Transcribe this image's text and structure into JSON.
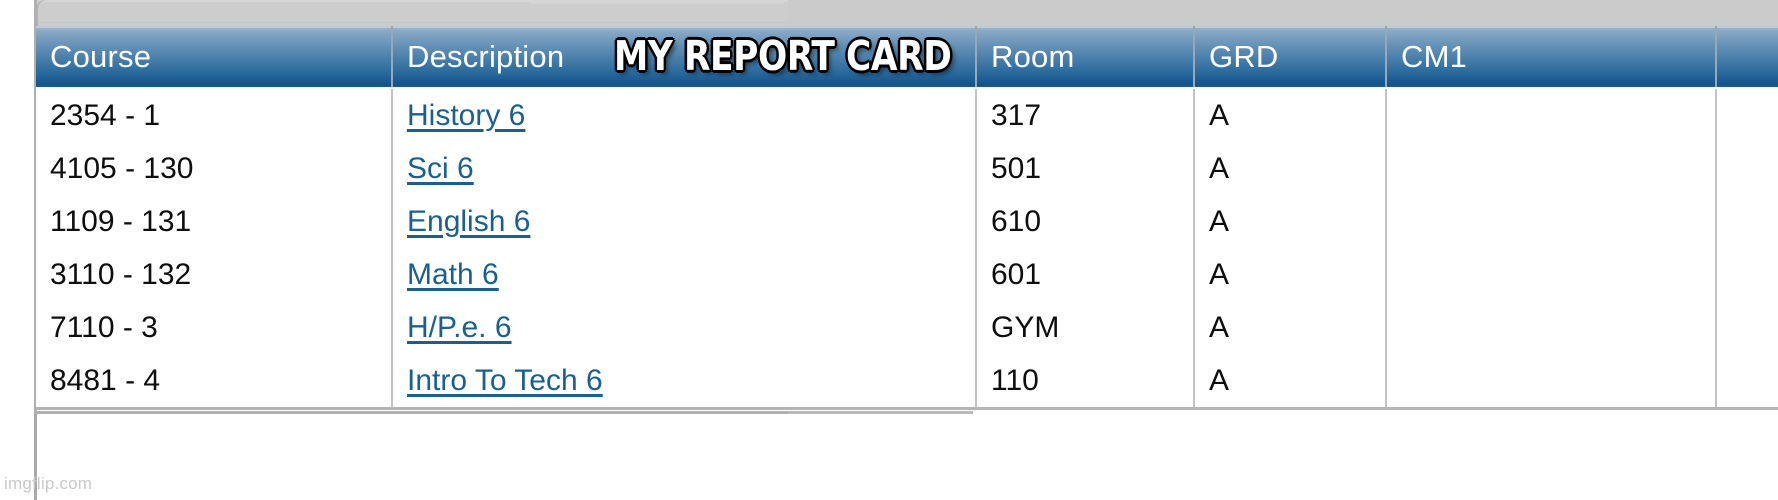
{
  "caption": {
    "text": "MY REPORT CARD"
  },
  "watermark": {
    "text": "imgflip.com"
  },
  "table": {
    "columns": [
      {
        "key": "course",
        "label": "Course"
      },
      {
        "key": "description",
        "label": "Description"
      },
      {
        "key": "room",
        "label": "Room"
      },
      {
        "key": "grd",
        "label": "GRD"
      },
      {
        "key": "cm1",
        "label": "CM1"
      },
      {
        "key": "extra",
        "label": ""
      }
    ],
    "rows": [
      {
        "course": "2354 - 1",
        "description": "History 6",
        "room": "317",
        "grd": "A",
        "cm1": "",
        "extra": ""
      },
      {
        "course": "4105 - 130",
        "description": "Sci 6",
        "room": "501",
        "grd": "A",
        "cm1": "",
        "extra": ""
      },
      {
        "course": "1109 - 131",
        "description": "English 6",
        "room": "610",
        "grd": "A",
        "cm1": "",
        "extra": ""
      },
      {
        "course": "3110 - 132",
        "description": "Math 6",
        "room": "601",
        "grd": "A",
        "cm1": "",
        "extra": ""
      },
      {
        "course": "7110 - 3",
        "description": "H/P.e. 6",
        "room": "GYM",
        "grd": "A",
        "cm1": "",
        "extra": ""
      },
      {
        "course": "8481 - 4",
        "description": "Intro To Tech 6",
        "room": "110",
        "grd": "A",
        "cm1": "",
        "extra": ""
      }
    ]
  },
  "colors": {
    "header_gradient_top": "#a9bed4",
    "header_gradient_bottom": "#14548c",
    "link": "#1a5f8f",
    "chrome": "#cccccc",
    "cell_border": "#c3c3c3",
    "caption_fill": "#ffffff",
    "caption_outline": "#000000"
  }
}
